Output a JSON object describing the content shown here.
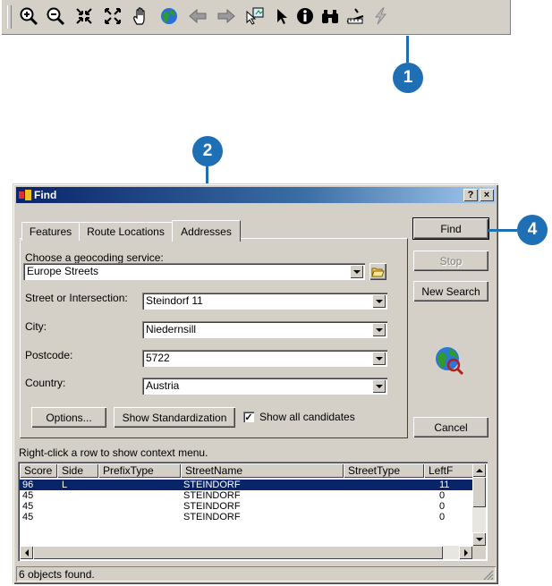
{
  "callouts": {
    "c1": "1",
    "c2": "2",
    "c4": "4"
  },
  "toolbar": {
    "tools": [
      "zoom-in-icon",
      "zoom-out-icon",
      "fixed-zoom-in-icon",
      "fixed-zoom-out-icon",
      "pan-hand-icon",
      "full-extent-globe-icon",
      "back-arrow-icon",
      "forward-arrow-icon",
      "select-features-icon",
      "select-elements-icon",
      "identify-icon",
      "find-binoculars-icon",
      "measure-icon",
      "hyperlink-bolt-icon"
    ]
  },
  "dialog": {
    "title": "Find",
    "help_btn": "?",
    "close_btn": "×",
    "tabs": [
      "Features",
      "Route Locations",
      "Addresses"
    ],
    "active_tab": "Addresses",
    "service_label": "Choose a geocoding service:",
    "service_value": "Europe Streets",
    "fields": [
      {
        "label": "Street or Intersection:",
        "value": "Steindorf 11"
      },
      {
        "label": "City:",
        "value": "Niedernsill"
      },
      {
        "label": "Postcode:",
        "value": "5722"
      },
      {
        "label": "Country:",
        "value": "Austria"
      }
    ],
    "options_btn": "Options...",
    "standardization_btn": "Show Standardization",
    "show_all_label": "Show all candidates",
    "show_all_checked": true,
    "find_btn": "Find",
    "stop_btn": "Stop",
    "new_search_btn": "New Search",
    "cancel_btn": "Cancel",
    "context_hint": "Right-click a row to show context menu.",
    "columns": [
      "Score",
      "Side",
      "PrefixType",
      "StreetName",
      "StreetType",
      "LeftF"
    ],
    "rows": [
      [
        "96",
        "L",
        "",
        "STEINDORF",
        "",
        "11"
      ],
      [
        "45",
        "",
        "",
        "STEINDORF",
        "",
        "0"
      ],
      [
        "45",
        "",
        "",
        "STEINDORF",
        "",
        "0"
      ],
      [
        "45",
        "",
        "",
        "STEINDORF",
        "",
        "0"
      ]
    ],
    "status": "6 objects found."
  },
  "colors": {
    "callout": "#1f6fb5",
    "title_bar": "#0a246a",
    "selection": "#0a246a"
  }
}
